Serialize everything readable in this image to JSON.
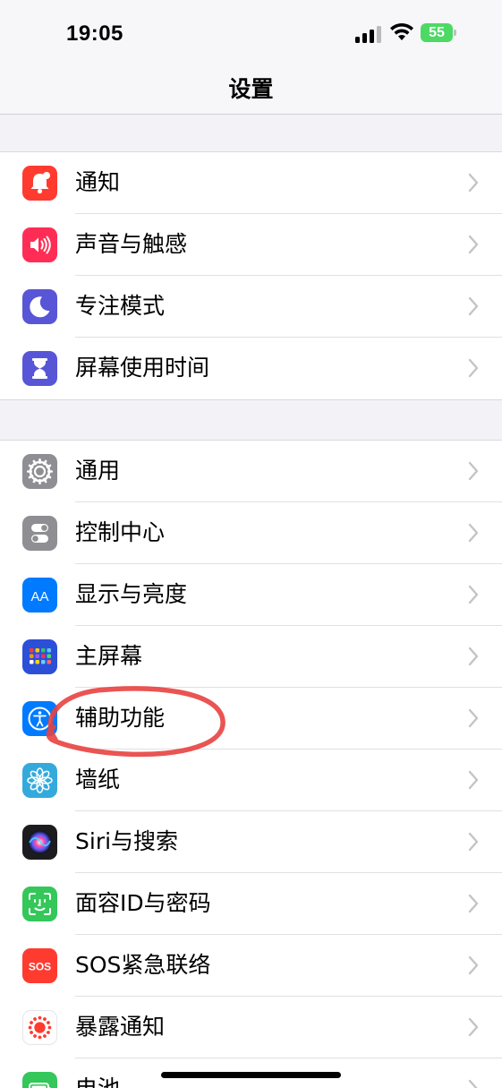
{
  "status_bar": {
    "time": "19:05",
    "battery": "55"
  },
  "nav": {
    "title": "设置"
  },
  "group1": [
    {
      "label": "通知",
      "icon": "bell-icon",
      "color": "#ff3b30"
    },
    {
      "label": "声音与触感",
      "icon": "speaker-icon",
      "color": "#ff2d55"
    },
    {
      "label": "专注模式",
      "icon": "moon-icon",
      "color": "#5856d6"
    },
    {
      "label": "屏幕使用时间",
      "icon": "hourglass-icon",
      "color": "#5856d6"
    }
  ],
  "group2": [
    {
      "label": "通用",
      "icon": "gear-icon",
      "color": "#8e8e93"
    },
    {
      "label": "控制中心",
      "icon": "toggles-icon",
      "color": "#8e8e93"
    },
    {
      "label": "显示与亮度",
      "icon": "text-size-icon",
      "color": "#007aff"
    },
    {
      "label": "主屏幕",
      "icon": "home-grid-icon",
      "color": "#2c4fd8"
    },
    {
      "label": "辅助功能",
      "icon": "accessibility-icon",
      "color": "#007aff"
    },
    {
      "label": "墙纸",
      "icon": "flower-icon",
      "color": "#34aadc"
    },
    {
      "label": "Siri与搜索",
      "icon": "siri-icon",
      "color": "#1c1c1e"
    },
    {
      "label": "面容ID与密码",
      "icon": "face-id-icon",
      "color": "#34c759"
    },
    {
      "label": "SOS紧急联络",
      "icon": "sos-icon",
      "color": "#ff3b30"
    },
    {
      "label": "暴露通知",
      "icon": "exposure-icon",
      "color": "#ffffff"
    },
    {
      "label": "电池",
      "icon": "battery-icon",
      "color": "#34c759"
    }
  ],
  "icon_texts": {
    "display": "AA",
    "sos": "SOS"
  },
  "annotation_color": "#e8413f"
}
